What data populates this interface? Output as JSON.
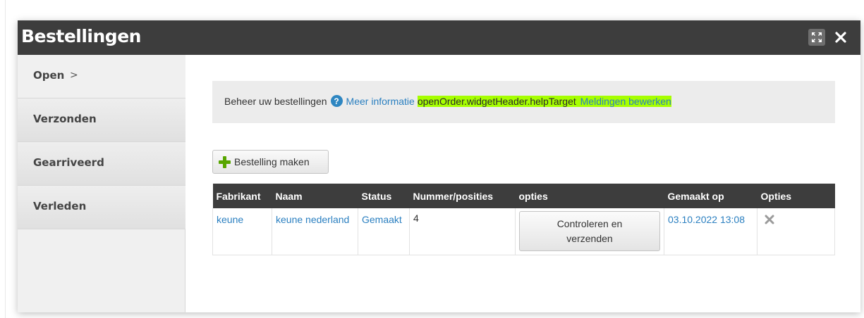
{
  "window": {
    "title": "Bestellingen",
    "expand_icon": "expand-icon",
    "close_icon": "close-icon"
  },
  "sidebar": {
    "items": [
      {
        "label": "Open",
        "active": true,
        "suffix": ">"
      },
      {
        "label": "Verzonden",
        "active": false
      },
      {
        "label": "Gearriveerd",
        "active": false
      },
      {
        "label": "Verleden",
        "active": false
      }
    ]
  },
  "info": {
    "text": "Beheer uw bestellingen",
    "help_icon": "help-icon",
    "more_info": "Meer informatie",
    "help_target": "openOrder.widgetHeader.helpTarget",
    "edit_notifications": "Meldingen bewerken",
    "highlight_color": "#a6ff00"
  },
  "toolbar": {
    "create_label": "Bestelling maken",
    "create_icon": "plus-icon"
  },
  "table": {
    "headers": [
      "Fabrikant",
      "Naam",
      "Status",
      "Nummer/posities",
      "opties",
      "Gemaakt op",
      "Opties"
    ],
    "rows": [
      {
        "fabrikant": "keune",
        "naam": "keune nederland",
        "status": "Gemaakt",
        "nummer": "4",
        "action": "Controleren en verzenden",
        "gemaakt_op": "03.10.2022 13:08",
        "delete_icon": "delete-icon"
      }
    ]
  },
  "colors": {
    "titlebar": "#3d3d3d",
    "link": "#2a7fc0",
    "accent_green": "#58a600"
  }
}
